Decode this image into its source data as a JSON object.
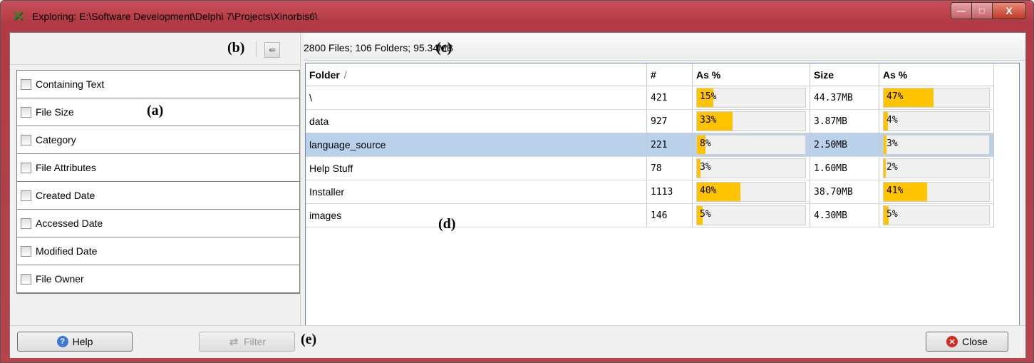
{
  "window": {
    "title": "Exploring: E:\\Software Development\\Delphi 7\\Projects\\Xinorbis6\\",
    "minimize_label": "—",
    "maximize_label": "□",
    "close_label": "X"
  },
  "annotations": {
    "a": "(a)",
    "b": "(b)",
    "c": "(c)",
    "d": "(d)",
    "e": "(e)"
  },
  "filters": [
    {
      "label": "Containing Text"
    },
    {
      "label": "File Size"
    },
    {
      "label": "Category"
    },
    {
      "label": "File Attributes"
    },
    {
      "label": "Created Date"
    },
    {
      "label": "Accessed Date"
    },
    {
      "label": "Modified Date"
    },
    {
      "label": "File Owner"
    }
  ],
  "summary": "2800 Files; 106 Folders; 95.34MB",
  "table": {
    "headers": {
      "folder": "Folder",
      "sort": "/",
      "count": "#",
      "count_pct": "As %",
      "size": "Size",
      "size_pct": "As %"
    },
    "rows": [
      {
        "folder": "\\",
        "count": "421",
        "count_pct": "15%",
        "count_frac": 0.15,
        "size": "44.37MB",
        "size_pct": "47%",
        "size_frac": 0.47
      },
      {
        "folder": "data",
        "count": "927",
        "count_pct": "33%",
        "count_frac": 0.33,
        "size": "3.87MB",
        "size_pct": "4%",
        "size_frac": 0.04
      },
      {
        "folder": "language_source",
        "count": "221",
        "count_pct": "8%",
        "count_frac": 0.08,
        "size": "2.50MB",
        "size_pct": "3%",
        "size_frac": 0.03,
        "selected": true
      },
      {
        "folder": "Help Stuff",
        "count": "78",
        "count_pct": "3%",
        "count_frac": 0.03,
        "size": "1.60MB",
        "size_pct": "2%",
        "size_frac": 0.02
      },
      {
        "folder": "Installer",
        "count": "1113",
        "count_pct": "40%",
        "count_frac": 0.4,
        "size": "38.70MB",
        "size_pct": "41%",
        "size_frac": 0.41
      },
      {
        "folder": "images",
        "count": "146",
        "count_pct": "5%",
        "count_frac": 0.05,
        "size": "4.30MB",
        "size_pct": "5%",
        "size_frac": 0.05
      }
    ]
  },
  "buttons": {
    "help": "Help",
    "filter": "Filter",
    "close": "Close"
  },
  "colors": {
    "bar": "#ffc300",
    "selected_row": "#b9d1ea",
    "title_bar": "#c9505a"
  },
  "icons": {
    "app": "xinorbis-icon",
    "export": "export-icon",
    "help": "help-icon",
    "filter": "refresh-icon",
    "close": "close-icon"
  }
}
